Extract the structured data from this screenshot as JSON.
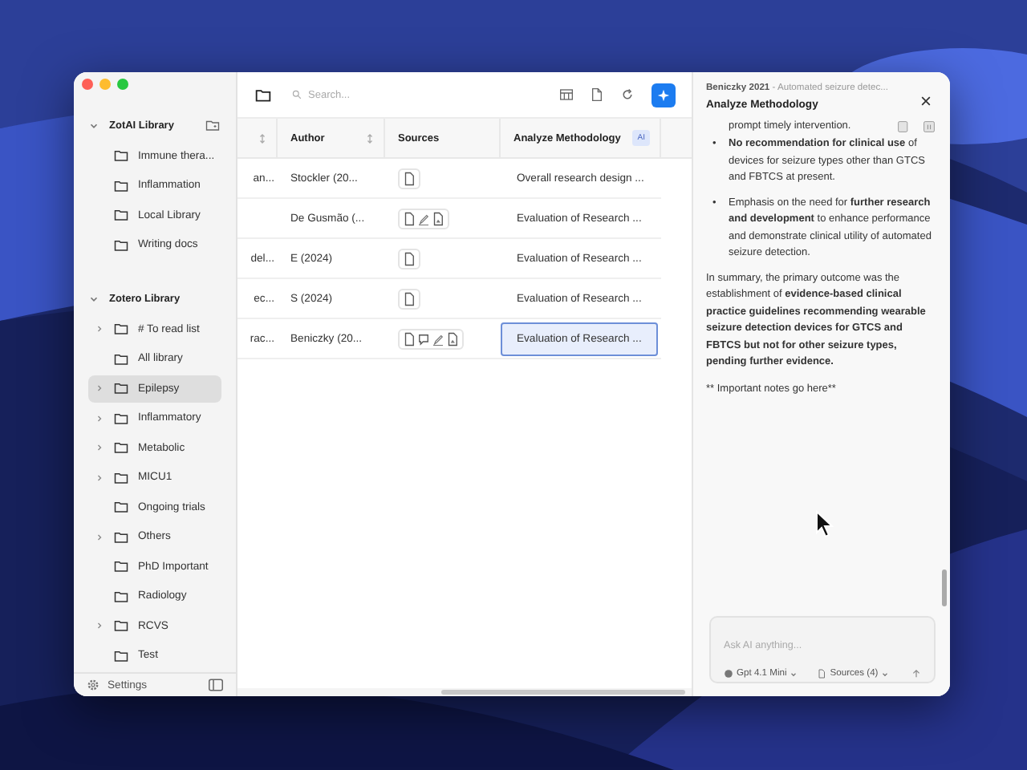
{
  "sidebar": {
    "sections": [
      {
        "title": "ZotAI Library",
        "expanded": true,
        "items": [
          {
            "label": "Immune thera...",
            "expandable": false,
            "selected": false
          },
          {
            "label": "Inflammation",
            "expandable": false,
            "selected": false
          },
          {
            "label": "Local Library",
            "expandable": false,
            "selected": false
          },
          {
            "label": "Writing docs",
            "expandable": false,
            "selected": false
          }
        ]
      },
      {
        "title": "Zotero Library",
        "expanded": true,
        "items": [
          {
            "label": "# To read list",
            "expandable": true,
            "selected": false
          },
          {
            "label": "All library",
            "expandable": false,
            "selected": false
          },
          {
            "label": "Epilepsy",
            "expandable": true,
            "selected": true
          },
          {
            "label": "Inflammatory",
            "expandable": true,
            "selected": false
          },
          {
            "label": "Metabolic",
            "expandable": true,
            "selected": false
          },
          {
            "label": "MICU1",
            "expandable": true,
            "selected": false
          },
          {
            "label": "Ongoing trials",
            "expandable": false,
            "selected": false
          },
          {
            "label": "Others",
            "expandable": true,
            "selected": false
          },
          {
            "label": "PhD Important",
            "expandable": false,
            "selected": false
          },
          {
            "label": "Radiology",
            "expandable": false,
            "selected": false
          },
          {
            "label": "RCVS",
            "expandable": true,
            "selected": false
          },
          {
            "label": "Test",
            "expandable": false,
            "selected": false
          }
        ]
      }
    ],
    "footer": {
      "label": "Settings"
    }
  },
  "toolbar": {
    "search": {
      "placeholder": "Search..."
    }
  },
  "table": {
    "columns": [
      {
        "sortable": true
      },
      {
        "label": "Author",
        "sortable": true
      },
      {
        "label": "Sources",
        "sortable": false
      },
      {
        "label": "Analyze Methodology",
        "sortable": false,
        "badge": "AI"
      }
    ],
    "rows": [
      {
        "column_1": "an...",
        "author": "Stockler (20...",
        "sources": [
          {
            "kind": "doc"
          }
        ],
        "methodology": "Overall research design ...",
        "selected": false
      },
      {
        "author": "De Gusmão (...",
        "sources": [
          {
            "kind": "doc"
          },
          {
            "kind": "pen"
          },
          {
            "kind": "pdf"
          }
        ],
        "methodology": "Evaluation of Research ...",
        "selected": false
      },
      {
        "column_1": "del...",
        "author": "E (2024)",
        "sources": [
          {
            "kind": "doc"
          }
        ],
        "methodology": "Evaluation of Research ...",
        "selected": false
      },
      {
        "column_1": "ec...",
        "author": "S (2024)",
        "sources": [
          {
            "kind": "doc"
          }
        ],
        "methodology": "Evaluation of Research ...",
        "selected": false
      },
      {
        "column_1": "rac...",
        "author": "Beniczky (20...",
        "sources": [
          {
            "kind": "doc"
          },
          {
            "kind": "comment"
          },
          {
            "kind": "pen"
          },
          {
            "kind": "pdf"
          }
        ],
        "methodology": "Evaluation of Research ...",
        "selected": true
      }
    ]
  },
  "panel": {
    "source": "Beniczky 2021",
    "subtitle": " - Automated seizure detec...",
    "title": "Analyze Methodology",
    "content": {
      "lead": "prompt timely intervention.",
      "bullets": [
        {
          "marker": "•",
          "text": "**No recommendation for clinical use** of devices for seizure types other than GTCS and FBTCS at present."
        },
        {
          "marker": "•",
          "text": "Emphasis on the need for **further research and development** to enhance performance and demonstrate clinical utility of automated seizure detection."
        }
      ],
      "summary": "In summary, the primary outcome was the establishment of **evidence-based clinical practice guidelines recommending wearable seizure detection devices for GTCS and FBTCS but not for other seizure types, pending further evidence.**",
      "note": "** Important notes go here**"
    },
    "chat": {
      "placeholder": "Ask AI anything...",
      "model": "Gpt 4.1 Mini",
      "sources": "Sources (4)"
    }
  }
}
